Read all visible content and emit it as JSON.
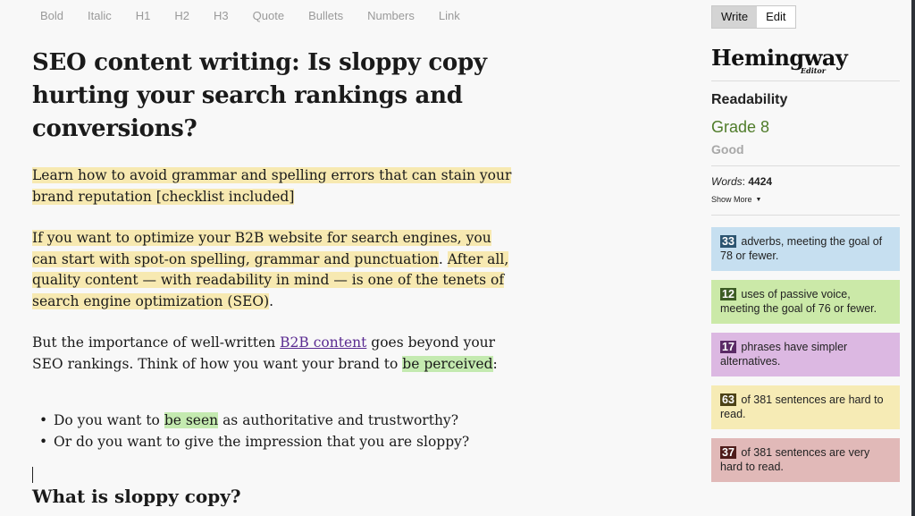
{
  "toolbar": {
    "buttons": [
      "Bold",
      "Italic",
      "H1",
      "H2",
      "H3",
      "Quote",
      "Bullets",
      "Numbers",
      "Link"
    ]
  },
  "document": {
    "title": "SEO content writing: Is sloppy copy hurting your search rankings and conversions?",
    "intro": "Learn how to avoid grammar and spelling errors that can stain your brand reputation [checklist included]",
    "para2_part1": "If you want to optimize your B2B website for search engines, you can start with spot-on spelling, grammar and punctuation",
    "para2_sep": ". ",
    "para2_part2": "After all, quality content — with readability in mind — is one of the tenets of search engine optimization (SEO)",
    "para2_end": ".",
    "para3_before_link": "But the importance of well-written ",
    "para3_link": "B2B content",
    "para3_after_link": " goes beyond your SEO rankings. Think of how you want your brand to ",
    "para3_highlight": "be perceived",
    "para3_end": ":",
    "bullets": [
      {
        "before": "Do you want to ",
        "highlight": "be seen",
        "after": " as authoritative and trustworthy?"
      },
      {
        "before": "Or do you want to give the impression that you are sloppy?",
        "highlight": "",
        "after": ""
      }
    ],
    "subheading": "What is sloppy copy?"
  },
  "sidebar": {
    "modes": {
      "write": "Write",
      "edit": "Edit",
      "active": "Write"
    },
    "logo": {
      "main": "Hemingway",
      "sub": "Editor"
    },
    "readability_label": "Readability",
    "grade": "Grade 8",
    "grade_desc": "Good",
    "words_label": "Words",
    "words_sep": ": ",
    "words_value": "4424",
    "show_more": "Show More",
    "cards": [
      {
        "count": "33",
        "text": " adverbs, meeting the goal of 78 or fewer.",
        "color": "#c6dff0"
      },
      {
        "count": "12",
        "text": " uses of passive voice, meeting the goal of 76 or fewer.",
        "color": "#cbe9a8"
      },
      {
        "count": "17",
        "text": " phrases have simpler alternatives.",
        "color": "#dcb8e2"
      },
      {
        "count": "63",
        "text": " of 381 sentences are hard to read.",
        "color": "#f6ebb5"
      },
      {
        "count": "37",
        "text": " of 381 sentences are very hard to read.",
        "color": "#e1b9b8"
      }
    ]
  },
  "colors": {
    "grade_green": "#4f7c2a",
    "highlight_yellow": "#f7e9b1",
    "highlight_green": "#c4eab0",
    "link_purple": "#5a2b91"
  }
}
